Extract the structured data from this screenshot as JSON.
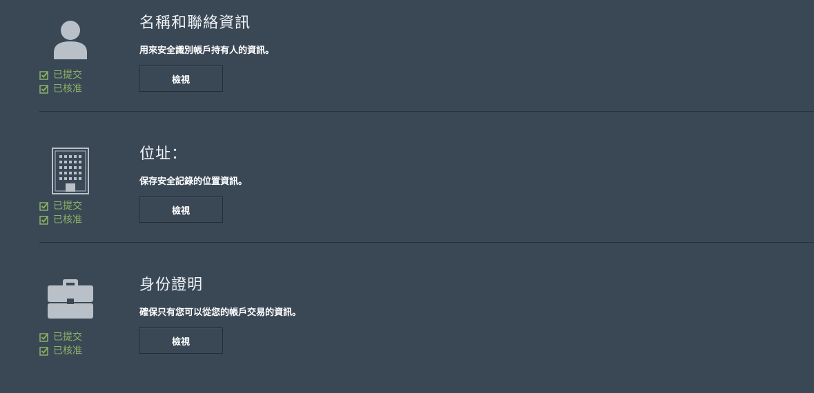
{
  "sections": [
    {
      "icon": "person-icon",
      "title": "名稱和聯絡資訊",
      "description": "用來安全識別帳戶持有人的資訊。",
      "button_label": "檢視",
      "statuses": [
        "已提交",
        "已核准"
      ]
    },
    {
      "icon": "building-icon",
      "title": "位址：",
      "description": "保存安全記錄的位置資訊。",
      "button_label": "檢視",
      "statuses": [
        "已提交",
        "已核准"
      ]
    },
    {
      "icon": "briefcase-icon",
      "title": "身份證明",
      "description": "確保只有您可以從您的帳戶交易的資訊。",
      "button_label": "檢視",
      "statuses": [
        "已提交",
        "已核准"
      ]
    }
  ],
  "colors": {
    "background": "#3a4856",
    "status_green": "#8eb365",
    "icon_gray": "#b9c0c7"
  }
}
